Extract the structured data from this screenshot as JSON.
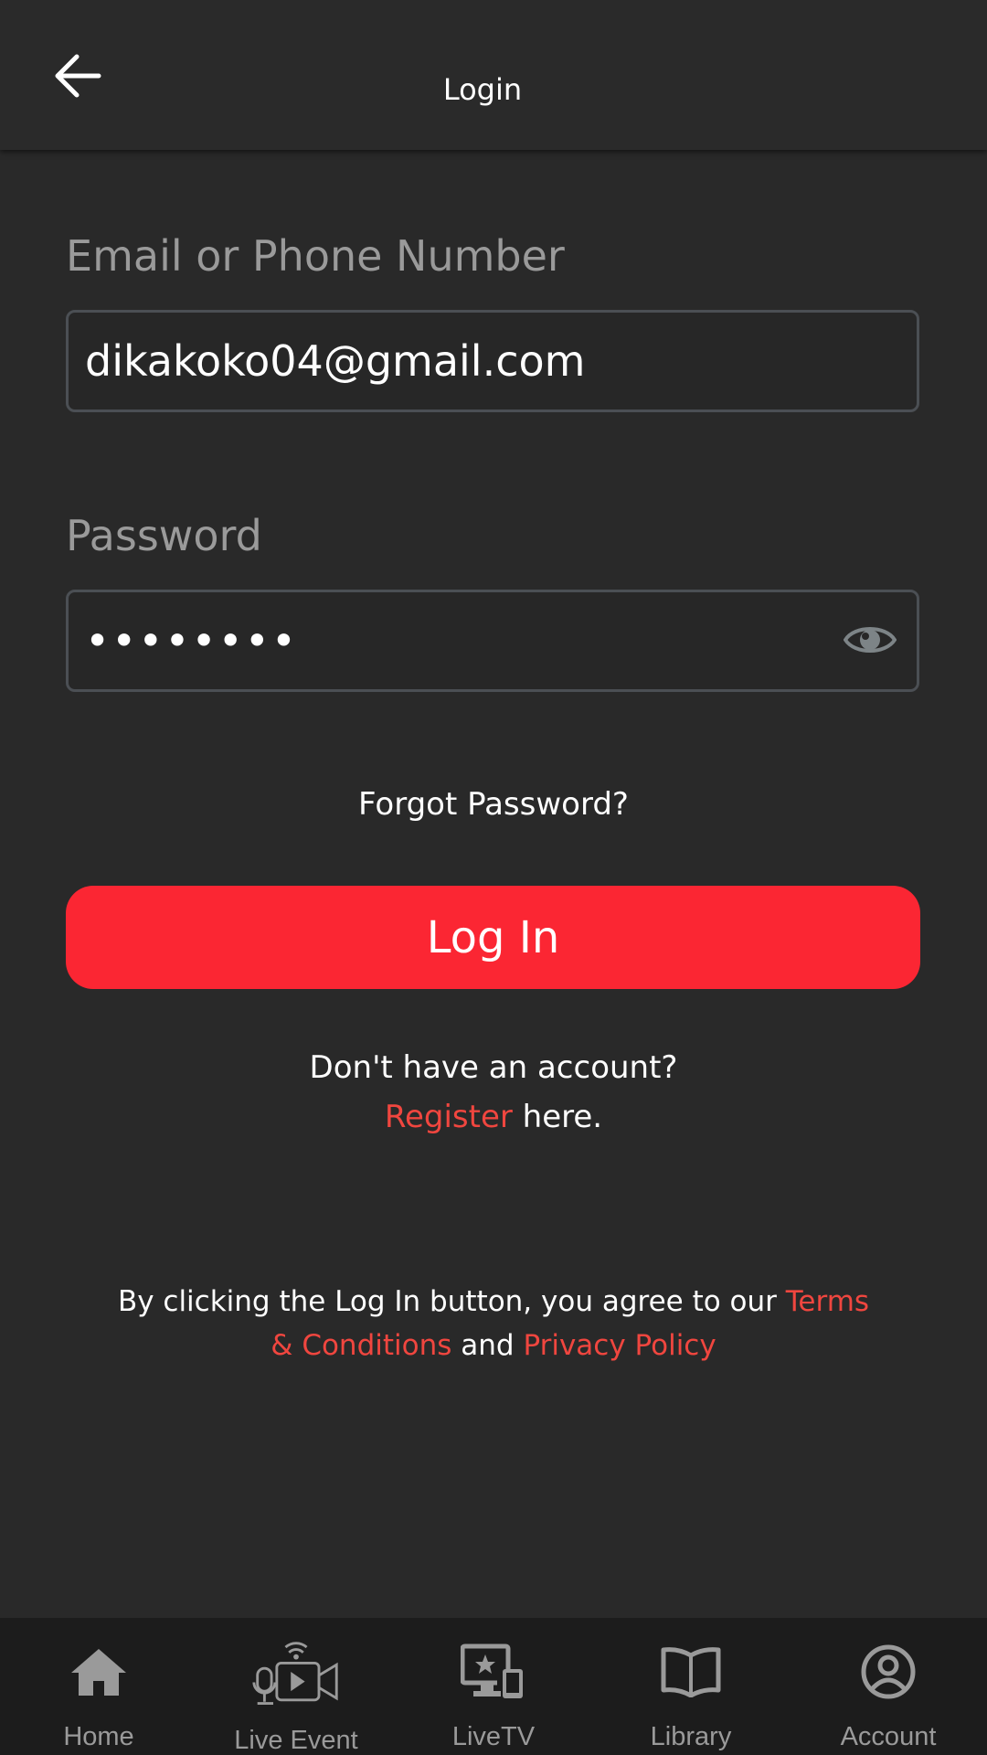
{
  "header": {
    "title": "Login",
    "back_icon": "arrow-left-icon"
  },
  "form": {
    "email_label": "Email or Phone Number",
    "email_value": "dikakoko04@gmail.com",
    "password_label": "Password",
    "password_value": "dikakoko",
    "eye_icon": "eye-icon",
    "forgot_password": "Forgot Password?",
    "login_button": "Log In"
  },
  "register": {
    "prompt": "Don't have an account?",
    "link": "Register",
    "suffix": " here."
  },
  "terms": {
    "prefix": "By clicking the Log In button, you agree to our ",
    "terms_link": "Terms & Conditions",
    "middle": " and ",
    "privacy_link": "Privacy Policy"
  },
  "bottom_nav": {
    "items": [
      {
        "label": "Home",
        "icon": "home-icon"
      },
      {
        "label": "Live Event",
        "icon": "live-event-icon"
      },
      {
        "label": "LiveTV",
        "icon": "livetv-icon"
      },
      {
        "label": "Library",
        "icon": "library-icon"
      },
      {
        "label": "Account",
        "icon": "account-icon"
      }
    ]
  },
  "colors": {
    "background": "#292929",
    "accent_red": "#fb2633",
    "link_red": "#f0463f",
    "label_gray": "#9a9a9a",
    "nav_background": "#1c1c1c"
  }
}
